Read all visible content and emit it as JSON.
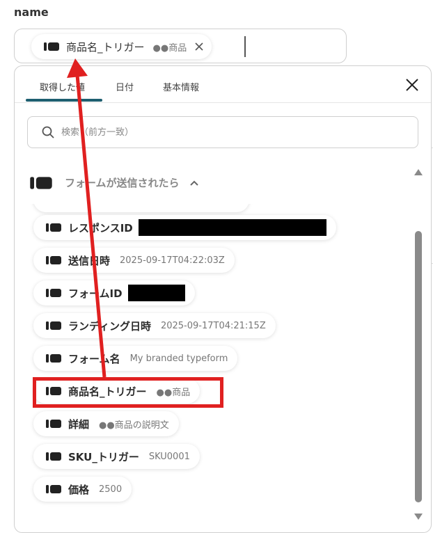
{
  "field_label": "name",
  "input_chip": {
    "label": "商品名_トリガー",
    "value": "●●商品"
  },
  "tabs": [
    {
      "label": "取得した値",
      "active": true
    },
    {
      "label": "日付",
      "active": false
    },
    {
      "label": "基本情報",
      "active": false
    }
  ],
  "search": {
    "placeholder": "検索（前方一致）"
  },
  "section": {
    "title": "フォームが送信されたら"
  },
  "items": [
    {
      "label": "レスポンスID",
      "value": ""
    },
    {
      "label": "送信日時",
      "value": "2025-09-17T04:22:03Z"
    },
    {
      "label": "フォームID",
      "value": ""
    },
    {
      "label": "ランディング日時",
      "value": "2025-09-17T04:21:15Z"
    },
    {
      "label": "フォーム名",
      "value": "My branded typeform"
    },
    {
      "label": "商品名_トリガー",
      "value": "●●商品"
    },
    {
      "label": "詳細",
      "value": "●●商品の説明文"
    },
    {
      "label": "SKU_トリガー",
      "value": "SKU0001"
    },
    {
      "label": "価格",
      "value": "2500"
    }
  ],
  "colors": {
    "accent": "#1e5f70",
    "annotation": "#e02020",
    "tag_icon": "#222222"
  }
}
